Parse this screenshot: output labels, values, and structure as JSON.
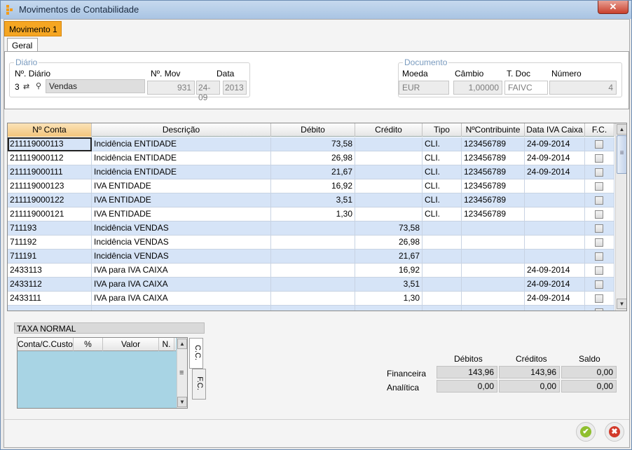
{
  "window": {
    "title": "Movimentos de Contabilidade",
    "close": "✕"
  },
  "tabs": {
    "movimento": "Movimento 1",
    "geral": "Geral"
  },
  "diario": {
    "group_label": "Diário",
    "num_label": "Nº. Diário",
    "num_value": "3",
    "name_value": "Vendas",
    "mov_label": "Nº. Mov",
    "mov_value": "931",
    "data_label": "Data",
    "day_value": "24-09",
    "year_value": "2013"
  },
  "documento": {
    "group_label": "Documento",
    "moeda_label": "Moeda",
    "moeda_value": "EUR",
    "cambio_label": "Câmbio",
    "cambio_value": "1,00000",
    "tdoc_label": "T. Doc",
    "tdoc_value": "FAIVC",
    "numero_label": "Número",
    "numero_value": "4"
  },
  "grid": {
    "headers": [
      "Nº Conta",
      "Descrição",
      "Débito",
      "Crédito",
      "Tipo",
      "NºContribuinte",
      "Data IVA Caixa",
      "F.C."
    ],
    "rows": [
      {
        "conta": "211119000113",
        "desc": "Incidência ENTIDADE",
        "debito": "73,58",
        "credito": "",
        "tipo": "CLI.",
        "contrib": "123456789",
        "data": "24-09-2014"
      },
      {
        "conta": "211119000112",
        "desc": "Incidência ENTIDADE",
        "debito": "26,98",
        "credito": "",
        "tipo": "CLI.",
        "contrib": "123456789",
        "data": "24-09-2014"
      },
      {
        "conta": "211119000111",
        "desc": "Incidência ENTIDADE",
        "debito": "21,67",
        "credito": "",
        "tipo": "CLI.",
        "contrib": "123456789",
        "data": "24-09-2014"
      },
      {
        "conta": "211119000123",
        "desc": "IVA ENTIDADE",
        "debito": "16,92",
        "credito": "",
        "tipo": "CLI.",
        "contrib": "123456789",
        "data": ""
      },
      {
        "conta": "211119000122",
        "desc": "IVA ENTIDADE",
        "debito": "3,51",
        "credito": "",
        "tipo": "CLI.",
        "contrib": "123456789",
        "data": ""
      },
      {
        "conta": "211119000121",
        "desc": "IVA ENTIDADE",
        "debito": "1,30",
        "credito": "",
        "tipo": "CLI.",
        "contrib": "123456789",
        "data": ""
      },
      {
        "conta": "711193",
        "desc": "Incidência VENDAS",
        "debito": "",
        "credito": "73,58",
        "tipo": "",
        "contrib": "",
        "data": ""
      },
      {
        "conta": "711192",
        "desc": "Incidência VENDAS",
        "debito": "",
        "credito": "26,98",
        "tipo": "",
        "contrib": "",
        "data": ""
      },
      {
        "conta": "711191",
        "desc": "Incidência VENDAS",
        "debito": "",
        "credito": "21,67",
        "tipo": "",
        "contrib": "",
        "data": ""
      },
      {
        "conta": "2433113",
        "desc": "IVA para IVA CAIXA",
        "debito": "",
        "credito": "16,92",
        "tipo": "",
        "contrib": "",
        "data": "24-09-2014"
      },
      {
        "conta": "2433112",
        "desc": "IVA para IVA CAIXA",
        "debito": "",
        "credito": "3,51",
        "tipo": "",
        "contrib": "",
        "data": "24-09-2014"
      },
      {
        "conta": "2433111",
        "desc": "IVA para IVA CAIXA",
        "debito": "",
        "credito": "1,30",
        "tipo": "",
        "contrib": "",
        "data": "24-09-2014"
      },
      {
        "conta": "",
        "desc": "",
        "debito": "",
        "credito": "",
        "tipo": "",
        "contrib": "",
        "data": ""
      }
    ]
  },
  "taxa": {
    "title": "TAXA NORMAL",
    "headers": [
      "Conta/C.Custo",
      "%",
      "Valor",
      "N."
    ],
    "tab_cc": "C.C.",
    "tab_fc": "F.C."
  },
  "totals": {
    "debitos_label": "Débitos",
    "creditos_label": "Créditos",
    "saldo_label": "Saldo",
    "financeira_label": "Financeira",
    "analitica_label": "Analítica",
    "financeira": [
      "143,96",
      "143,96",
      "0,00"
    ],
    "analitica": [
      "0,00",
      "0,00",
      "0,00"
    ]
  },
  "actions": {
    "ok_glyph": "✔",
    "cancel_glyph": "✖"
  },
  "colors": {
    "accent_tab": "#f5a623",
    "row_alt": "#d6e4f7",
    "ok": "#8fbf2f",
    "cancel": "#d23a2a"
  }
}
